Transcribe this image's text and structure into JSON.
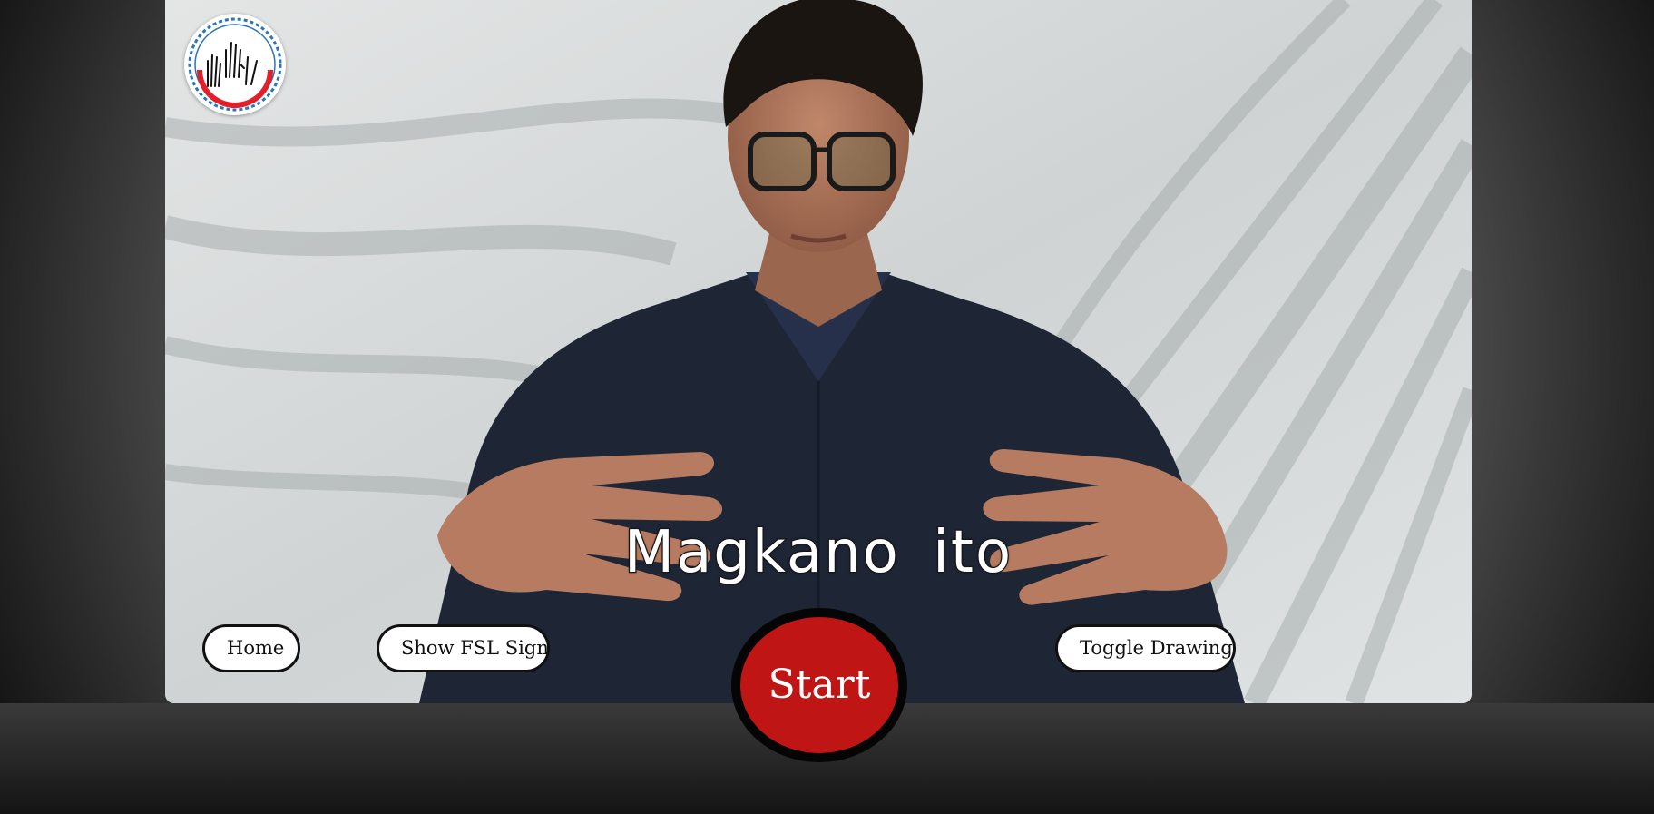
{
  "caption": {
    "text": "Magkano ito"
  },
  "logo": {
    "icon": "fsl-hands-logo-icon"
  },
  "buttons": {
    "home": "Home",
    "show_fsl_sign": "Show FSL Sign",
    "toggle_drawing": "Toggle Drawing",
    "start": "Start"
  },
  "colors": {
    "start_button": "#c01515",
    "button_background": "#ffffff",
    "button_border": "#111111",
    "caption_text": "#ffffff"
  }
}
